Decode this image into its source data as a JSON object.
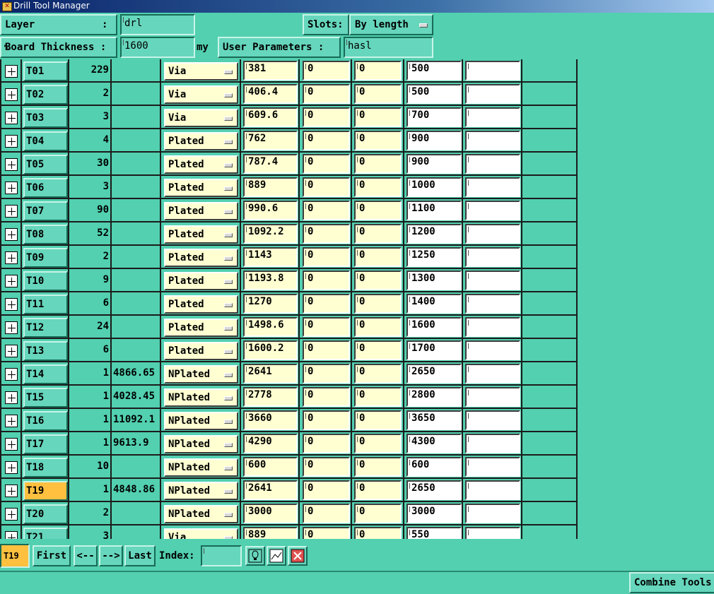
{
  "window": {
    "title": "Drill Tool Manager"
  },
  "header": {
    "layer_label": "Layer",
    "layer_colon": ":",
    "layer_value": "drl",
    "slots_label": "Slots:",
    "slots_value": "By length",
    "thickness_label": "Board Thickness :",
    "thickness_value": "1600",
    "thickness_unit": "my",
    "user_params_label": "User Parameters :",
    "user_params_value": "hasl"
  },
  "tools": [
    {
      "tool": "T01",
      "count": "229",
      "length": "",
      "type": "Via",
      "size": "381",
      "v1": "0",
      "v2": "0",
      "finish": "500",
      "extra": ""
    },
    {
      "tool": "T02",
      "count": "2",
      "length": "",
      "type": "Via",
      "size": "406.4",
      "v1": "0",
      "v2": "0",
      "finish": "500",
      "extra": ""
    },
    {
      "tool": "T03",
      "count": "3",
      "length": "",
      "type": "Via",
      "size": "609.6",
      "v1": "0",
      "v2": "0",
      "finish": "700",
      "extra": ""
    },
    {
      "tool": "T04",
      "count": "4",
      "length": "",
      "type": "Plated",
      "size": "762",
      "v1": "0",
      "v2": "0",
      "finish": "900",
      "extra": ""
    },
    {
      "tool": "T05",
      "count": "30",
      "length": "",
      "type": "Plated",
      "size": "787.4",
      "v1": "0",
      "v2": "0",
      "finish": "900",
      "extra": ""
    },
    {
      "tool": "T06",
      "count": "3",
      "length": "",
      "type": "Plated",
      "size": "889",
      "v1": "0",
      "v2": "0",
      "finish": "1000",
      "extra": ""
    },
    {
      "tool": "T07",
      "count": "90",
      "length": "",
      "type": "Plated",
      "size": "990.6",
      "v1": "0",
      "v2": "0",
      "finish": "1100",
      "extra": ""
    },
    {
      "tool": "T08",
      "count": "52",
      "length": "",
      "type": "Plated",
      "size": "1092.2",
      "v1": "0",
      "v2": "0",
      "finish": "1200",
      "extra": ""
    },
    {
      "tool": "T09",
      "count": "2",
      "length": "",
      "type": "Plated",
      "size": "1143",
      "v1": "0",
      "v2": "0",
      "finish": "1250",
      "extra": ""
    },
    {
      "tool": "T10",
      "count": "9",
      "length": "",
      "type": "Plated",
      "size": "1193.8",
      "v1": "0",
      "v2": "0",
      "finish": "1300",
      "extra": ""
    },
    {
      "tool": "T11",
      "count": "6",
      "length": "",
      "type": "Plated",
      "size": "1270",
      "v1": "0",
      "v2": "0",
      "finish": "1400",
      "extra": ""
    },
    {
      "tool": "T12",
      "count": "24",
      "length": "",
      "type": "Plated",
      "size": "1498.6",
      "v1": "0",
      "v2": "0",
      "finish": "1600",
      "extra": ""
    },
    {
      "tool": "T13",
      "count": "6",
      "length": "",
      "type": "Plated",
      "size": "1600.2",
      "v1": "0",
      "v2": "0",
      "finish": "1700",
      "extra": ""
    },
    {
      "tool": "T14",
      "count": "1",
      "length": "4866.65",
      "type": "NPlated",
      "size": "2641",
      "v1": "0",
      "v2": "0",
      "finish": "2650",
      "extra": ""
    },
    {
      "tool": "T15",
      "count": "1",
      "length": "4028.45",
      "type": "NPlated",
      "size": "2778",
      "v1": "0",
      "v2": "0",
      "finish": "2800",
      "extra": ""
    },
    {
      "tool": "T16",
      "count": "1",
      "length": "11092.1",
      "type": "NPlated",
      "size": "3660",
      "v1": "0",
      "v2": "0",
      "finish": "3650",
      "extra": ""
    },
    {
      "tool": "T17",
      "count": "1",
      "length": "9613.9",
      "type": "NPlated",
      "size": "4290",
      "v1": "0",
      "v2": "0",
      "finish": "4300",
      "extra": ""
    },
    {
      "tool": "T18",
      "count": "10",
      "length": "",
      "type": "NPlated",
      "size": "600",
      "v1": "0",
      "v2": "0",
      "finish": "600",
      "extra": ""
    },
    {
      "tool": "T19",
      "count": "1",
      "length": "4848.86",
      "type": "NPlated",
      "size": "2641",
      "v1": "0",
      "v2": "0",
      "finish": "2650",
      "extra": "",
      "selected": true
    },
    {
      "tool": "T20",
      "count": "2",
      "length": "",
      "type": "NPlated",
      "size": "3000",
      "v1": "0",
      "v2": "0",
      "finish": "3000",
      "extra": ""
    },
    {
      "tool": "T21",
      "count": "3",
      "length": "",
      "type": "Via",
      "size": "889",
      "v1": "0",
      "v2": "0",
      "finish": "550",
      "extra": ""
    }
  ],
  "nav": {
    "current": "T19",
    "first": "First",
    "prev": "<--",
    "next": "-->",
    "last": "Last",
    "index_label": "Index:",
    "index_value": ""
  },
  "footer": {
    "combine_label": "Combine Tools"
  },
  "colors": {
    "background": "#52d0b0",
    "field_yellow": "#ffffd2",
    "selected_tool": "#ffc040"
  }
}
